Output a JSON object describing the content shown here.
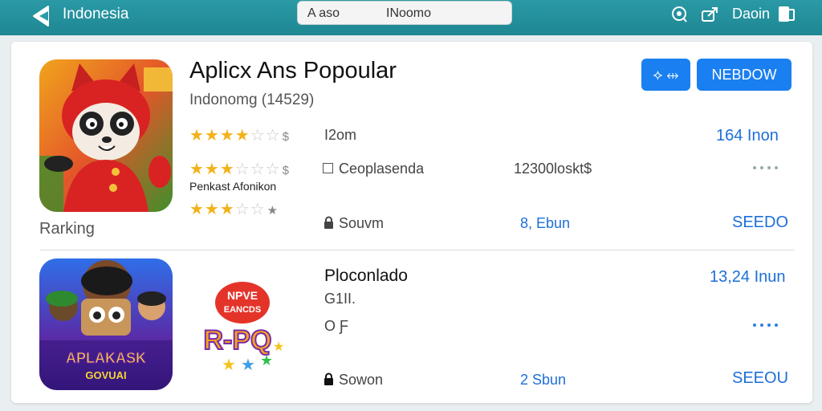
{
  "topbar": {
    "region": "Indonesia",
    "search_query_1": "A aso",
    "search_query_2": "INoomo",
    "account_label": "Daoin"
  },
  "app1": {
    "title": "Aplicx Ans Popoular",
    "subtitle": "Indonomg (14529)",
    "ranking_label": "Rarking",
    "author": "Penkast Afonikon",
    "stars": [
      {
        "on": "★★★★",
        "off": "☆☆",
        "suffix": "$"
      },
      {
        "on": "★★★",
        "off": "☆☆☆",
        "suffix": "$"
      },
      {
        "on": "★★★",
        "off": "☆☆",
        "suffix": "★"
      }
    ],
    "row1": {
      "mid": "I2om",
      "right": "164 Inon"
    },
    "row2": {
      "mid": "Ceoplasenda",
      "value": "12300loskt$"
    },
    "row3": {
      "mid": "Souvm",
      "blue": "8, Ebun",
      "right": "SEEDO"
    },
    "icon_button_label": "⟡ ⇹",
    "primary_button_label": "NEBDOW"
  },
  "app2": {
    "title": "Ploconlado",
    "line2": "G1II.",
    "line3": "O Ƒ",
    "logo_text_1": "NPVE",
    "logo_text_2": "EANCDS",
    "logo_text_3": "R-PQ",
    "icon_text_1": "APLAKASK",
    "icon_text_2": "GOVUAI",
    "right": "13,24 Inun",
    "row3": {
      "mid": "Sowon",
      "blue": "2 Sbun",
      "right": "SEEOU"
    }
  },
  "colors": {
    "topbar": "#1e8792",
    "accent": "#1a7ff0",
    "star": "#f2b21b"
  },
  "icons": [
    "back-arrow-icon",
    "search-icon",
    "location-icon",
    "share-icon",
    "device-icon",
    "lock-icon",
    "dots-icon"
  ]
}
